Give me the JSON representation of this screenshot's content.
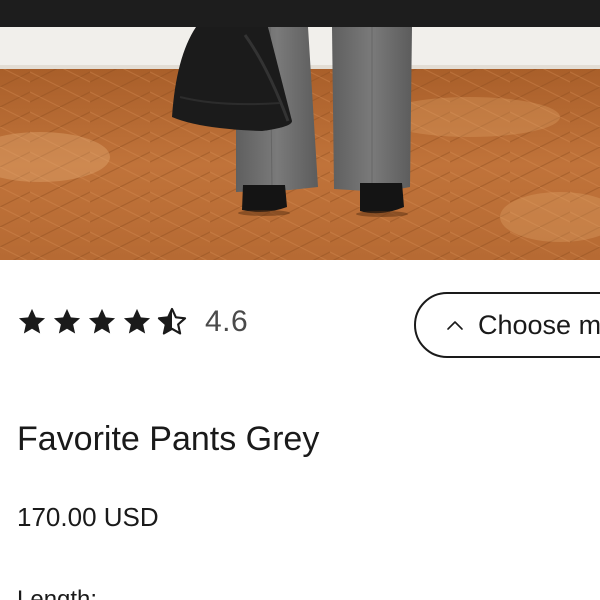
{
  "product": {
    "rating_value": "4.6",
    "rating_stars": 4.6,
    "title": "Favorite Pants Grey",
    "price": "170.00 USD",
    "length_label": "Length:"
  },
  "size_selector": {
    "label": "Choose m"
  },
  "colors": {
    "topbar": "#1d1d1d",
    "floor": "#b86a30",
    "wall": "#f3f1ed",
    "trousers": "#707070",
    "text": "#1a1a1a",
    "rating_text": "#4a4a4a",
    "star_fill": "#1a1a1a"
  },
  "icons": {
    "star": "star-icon",
    "half_star": "half-star-icon",
    "chevron": "chevron-up-icon"
  }
}
